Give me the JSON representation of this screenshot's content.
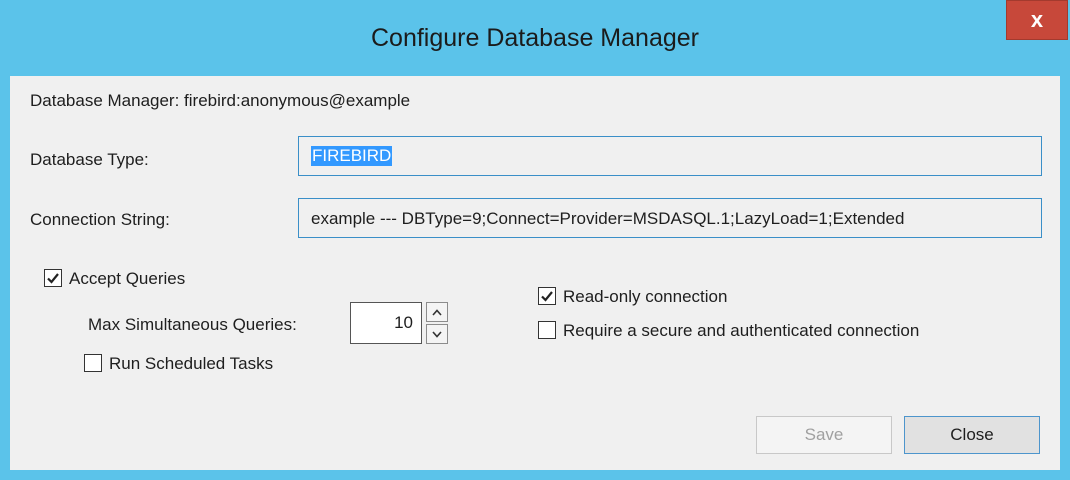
{
  "window": {
    "title": "Configure Database Manager",
    "close_glyph": "x"
  },
  "manager_line": "Database Manager: firebird:anonymous@example",
  "db_type": {
    "label": "Database Type:",
    "value": "FIREBIRD"
  },
  "connection": {
    "label": "Connection String:",
    "value": "example --- DBType=9;Connect=Provider=MSDASQL.1;LazyLoad=1;Extended"
  },
  "accept_queries": {
    "label": "Accept Queries",
    "checked": true
  },
  "max_queries": {
    "label": "Max Simultaneous Queries:",
    "value": "10"
  },
  "run_tasks": {
    "label": "Run Scheduled Tasks",
    "checked": false
  },
  "read_only": {
    "label": "Read-only connection",
    "checked": true
  },
  "secure": {
    "label": "Require a secure and authenticated connection",
    "checked": false
  },
  "buttons": {
    "save": "Save",
    "close": "Close"
  },
  "colors": {
    "titlebar": "#5bc3ea",
    "close_button": "#c7483a",
    "selection": "#3399ff"
  }
}
